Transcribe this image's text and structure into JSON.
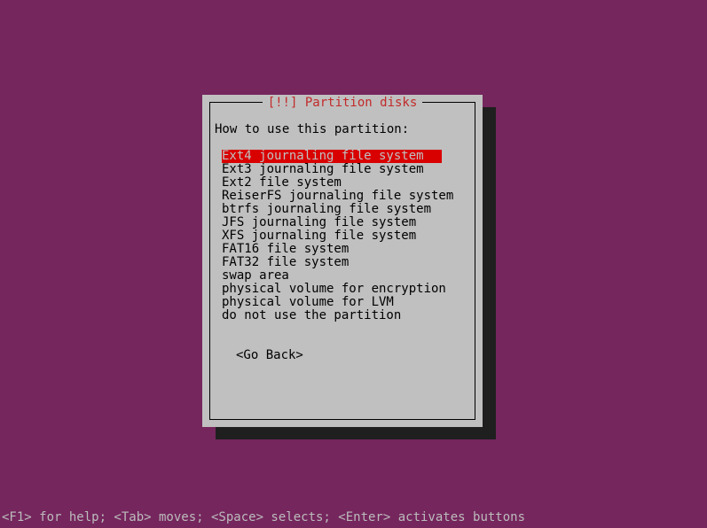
{
  "dialog": {
    "title_prefix": "[!!] ",
    "title": "Partition disks",
    "prompt": "How to use this partition:",
    "selected_index": 0,
    "options": [
      "Ext4 journaling file system",
      "Ext3 journaling file system",
      "Ext2 file system",
      "ReiserFS journaling file system",
      "btrfs journaling file system",
      "JFS journaling file system",
      "XFS journaling file system",
      "FAT16 file system",
      "FAT32 file system",
      "swap area",
      "physical volume for encryption",
      "physical volume for LVM",
      "do not use the partition"
    ],
    "go_back": "<Go Back>"
  },
  "helpbar": "<F1> for help; <Tab> moves; <Space> selects; <Enter> activates buttons"
}
